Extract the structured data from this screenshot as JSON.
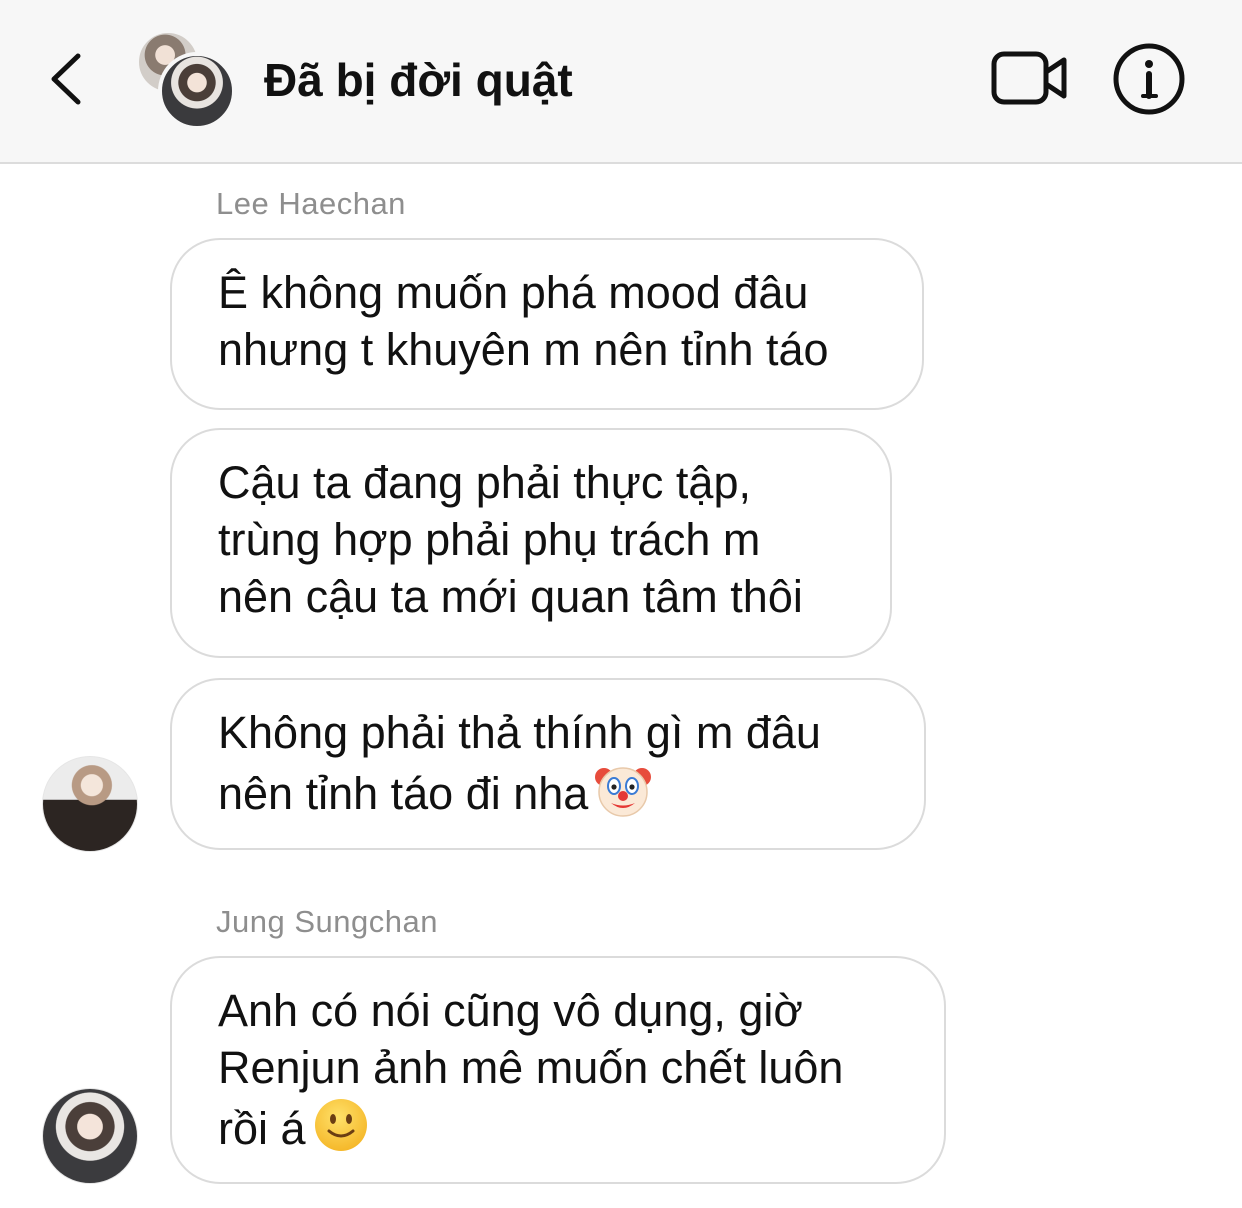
{
  "header": {
    "title": "Đã bị đời quật",
    "back_icon": "chevron-left-icon",
    "video_icon": "video-camera-icon",
    "info_icon": "info-icon"
  },
  "messages": [
    {
      "sender": "Lee Haechan",
      "bubbles": [
        {
          "text": "Ê không muốn phá mood đâu\nnhưng t khuyên m nên tỉnh táo"
        },
        {
          "text": "Cậu ta đang phải thực tập,\ntrùng hợp phải phụ trách m\nnên cậu ta mới quan tâm thôi"
        },
        {
          "text": "Không phải thả thính gì m đâu\nnên tỉnh táo đi nha",
          "emoji": "clown-face-emoji"
        }
      ]
    },
    {
      "sender": "Jung Sungchan",
      "bubbles": [
        {
          "text": "Anh có nói cũng vô dụng, giờ\nRenjun ảnh mê muốn chết luôn\nrồi á",
          "emoji": "slightly-smiling-face-emoji"
        }
      ]
    }
  ],
  "colors": {
    "header_bg": "#f7f7f7",
    "bubble_border": "#dbdbdb",
    "sender_text": "#8e8e8e",
    "message_text": "#111111"
  }
}
